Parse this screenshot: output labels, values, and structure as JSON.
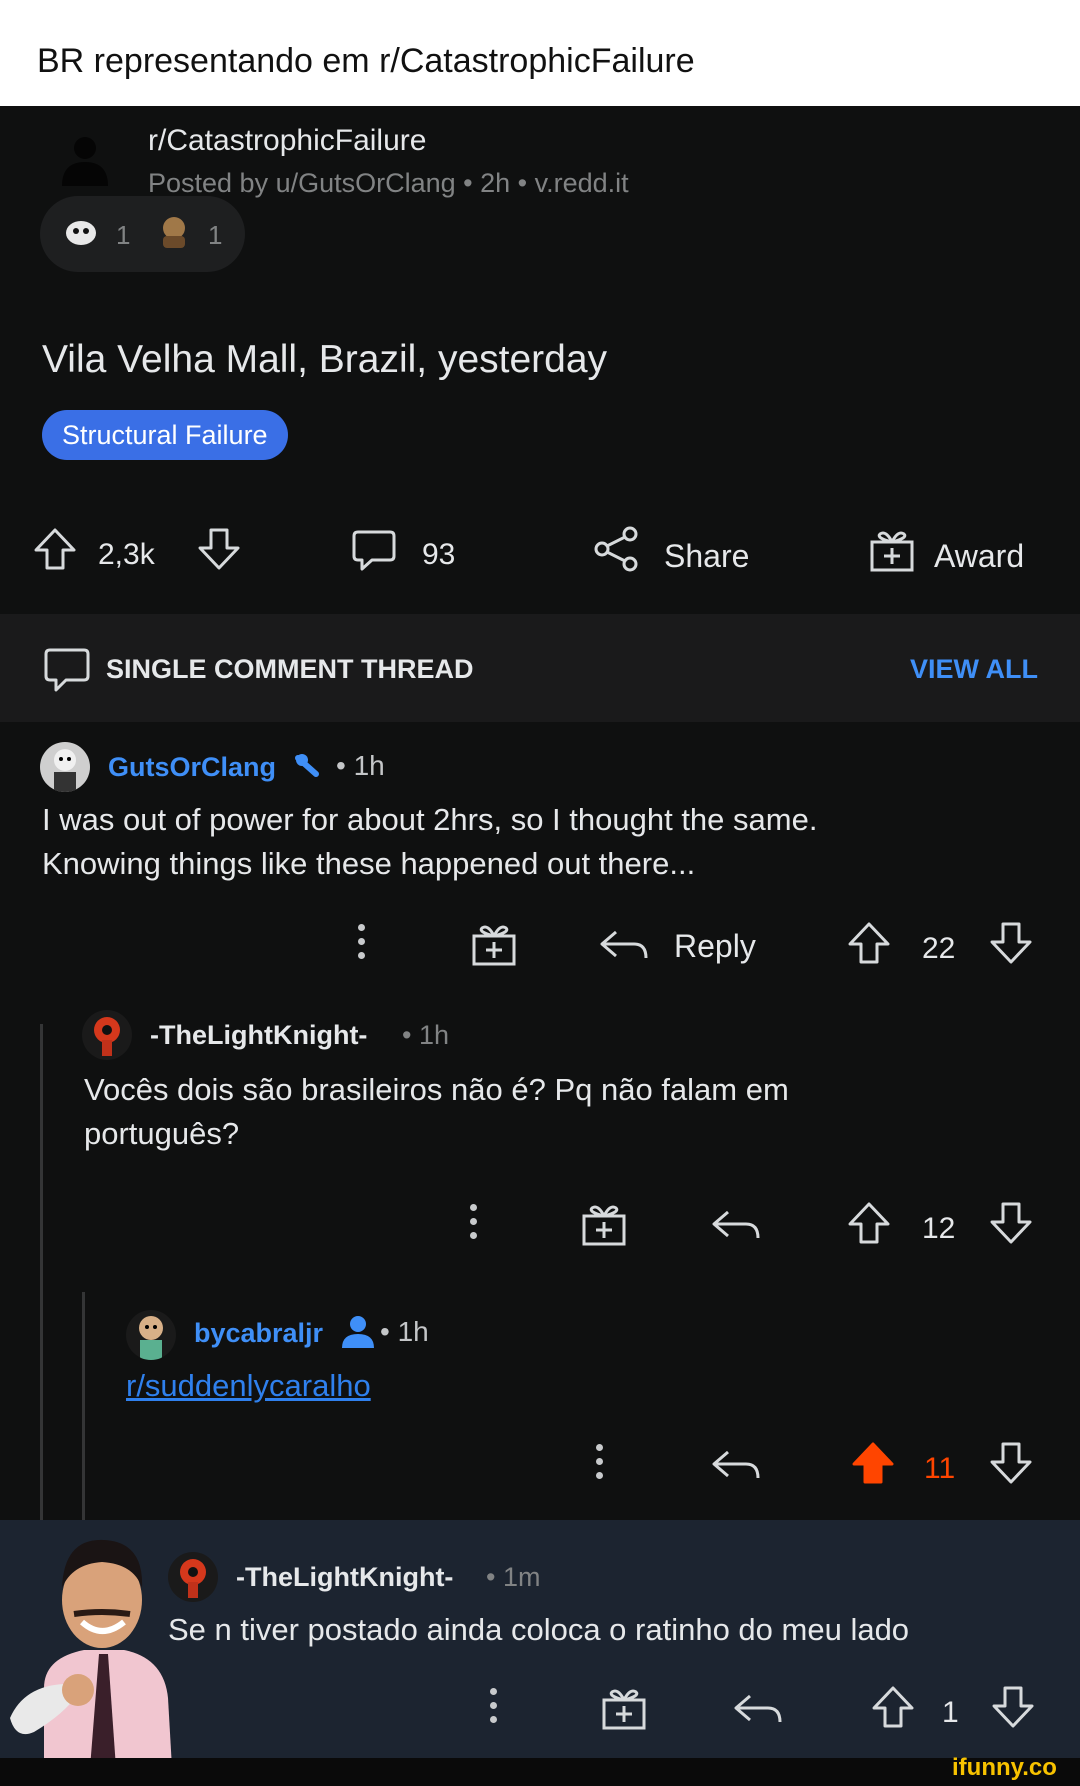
{
  "caption": "BR representando em r/CatastrophicFailure",
  "post": {
    "subreddit": "r/CatastrophicFailure",
    "meta": "Posted by u/GutsOrClang • 2h • v.redd.it",
    "awards": [
      {
        "icon": "award-icon-1",
        "count": "1"
      },
      {
        "icon": "award-icon-2",
        "count": "1"
      }
    ],
    "title": "Vila Velha Mall, Brazil, yesterday",
    "flair": "Structural Failure",
    "votes": "2,3k",
    "comments": "93",
    "share_label": "Share",
    "award_label": "Award"
  },
  "thread_bar": {
    "label": "SINGLE COMMENT THREAD",
    "view_all": "VIEW ALL"
  },
  "comments": [
    {
      "author": "GutsOrClang",
      "time": "• 1h",
      "text_line1": "I was out of power for about 2hrs, so I thought the same.",
      "text_line2": "Knowing things like these happened out there...",
      "reply_label": "Reply",
      "votes": "22"
    },
    {
      "author": "-TheLightKnight-",
      "time": "• 1h",
      "text_line1": "Vocês dois são brasileiros não é? Pq não falam em",
      "text_line2": "português?",
      "votes": "12"
    },
    {
      "author": "bycabraljr",
      "time": "• 1h",
      "link": "r/suddenlycaralho",
      "votes": "11"
    },
    {
      "author": "-TheLightKnight-",
      "time": "• 1m",
      "text_line1": "Se n tiver postado ainda coloca o ratinho do meu lado",
      "votes": "1"
    }
  ],
  "watermark": "ifunny.co",
  "colors": {
    "background": "#0f1010",
    "accent_blue": "#3f8ff7",
    "upvote_orange": "#ff4500",
    "highlight": "#1c2430"
  }
}
